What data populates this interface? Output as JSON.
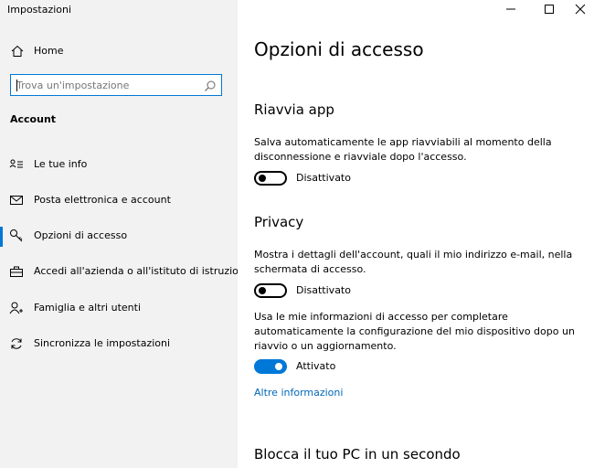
{
  "window": {
    "title": "Impostazioni",
    "controls": [
      "minimize-icon",
      "maximize-icon",
      "close-icon"
    ]
  },
  "sidebar": {
    "home_label": "Home",
    "home_icon": "home-icon",
    "search": {
      "placeholder": "Trova un'impostazione",
      "value": "",
      "icon": "search-icon"
    },
    "section_label": "Account",
    "items": [
      {
        "label": "Le tue info",
        "icon": "person-card-icon",
        "active": false
      },
      {
        "label": "Posta elettronica e account",
        "icon": "mail-icon",
        "active": false
      },
      {
        "label": "Opzioni di accesso",
        "icon": "key-icon",
        "active": true
      },
      {
        "label": "Accedi all'azienda o all'istituto di istruzione",
        "icon": "briefcase-icon",
        "active": false
      },
      {
        "label": "Famiglia e altri utenti",
        "icon": "add-person-icon",
        "active": false
      },
      {
        "label": "Sincronizza le impostazioni",
        "icon": "sync-icon",
        "active": false
      }
    ]
  },
  "main": {
    "title": "Opzioni di accesso",
    "restart_apps": {
      "heading": "Riavvia app",
      "description": "Salva automaticamente le app riavviabili al momento della disconnessione e riavviale dopo l'accesso.",
      "toggle_state": "Disattivato",
      "toggle_on": false
    },
    "privacy": {
      "heading": "Privacy",
      "show_details": {
        "description": "Mostra i dettagli dell'account, quali il mio indirizzo e-mail, nella schermata di accesso.",
        "toggle_state": "Disattivato",
        "toggle_on": false
      },
      "use_signin_info": {
        "description": "Usa le mie informazioni di accesso per completare automaticamente la configurazione del mio dispositivo dopo un riavvio o un aggiornamento.",
        "toggle_state": "Attivato",
        "toggle_on": true
      },
      "more_info_link": "Altre informazioni"
    },
    "lock_section_heading": "Blocca il tuo PC in un secondo"
  },
  "colors": {
    "accent": "#0078d7",
    "link": "#0067b8",
    "sidebar_bg": "#f2f2f2",
    "main_bg": "#ffffff"
  }
}
